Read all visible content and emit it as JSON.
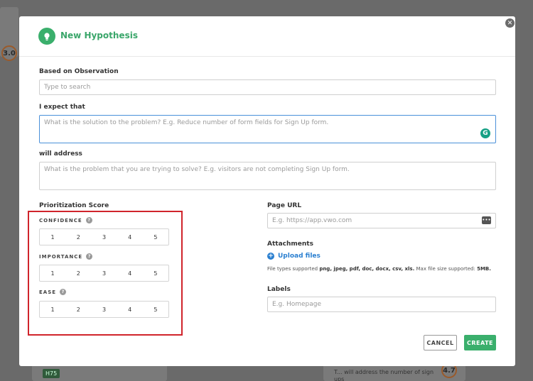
{
  "background": {
    "score_left": "3.0",
    "score_right": "4.7",
    "tag": "H75",
    "card_text_1": "T... will address the number of sign",
    "card_text_2": "ups"
  },
  "modal": {
    "title": "New Hypothesis",
    "close_icon": "close-icon"
  },
  "form": {
    "observation": {
      "label": "Based on Observation",
      "placeholder": "Type to search"
    },
    "expect": {
      "label": "I expect that",
      "placeholder": "What is the solution to the problem? E.g. Reduce number of form fields for Sign Up form."
    },
    "address": {
      "label": "will address",
      "placeholder": "What is the problem that you are trying to solve? E.g. visitors are not completing Sign Up form."
    }
  },
  "prioritization": {
    "title": "Prioritization Score",
    "confidence": {
      "label": "CONFIDENCE",
      "options": [
        "1",
        "2",
        "3",
        "4",
        "5"
      ]
    },
    "importance": {
      "label": "IMPORTANCE",
      "options": [
        "1",
        "2",
        "3",
        "4",
        "5"
      ]
    },
    "ease": {
      "label": "EASE",
      "options": [
        "1",
        "2",
        "3",
        "4",
        "5"
      ]
    }
  },
  "page_url": {
    "label": "Page URL",
    "placeholder": "E.g. https://app.vwo.com"
  },
  "attachments": {
    "label": "Attachments",
    "upload_label": "Upload files",
    "supported_prefix": "File types supported",
    "supported_types": "png, jpeg, pdf, doc, docx, csv, xls.",
    "max_prefix": "Max file size supported:",
    "max_size": "5MB."
  },
  "labels": {
    "label": "Labels",
    "placeholder": "E.g. Homepage"
  },
  "buttons": {
    "cancel": "CANCEL",
    "create": "CREATE"
  },
  "colors": {
    "accent": "#3aaf6c",
    "link": "#2a7fd0",
    "highlight": "#d0242b"
  }
}
